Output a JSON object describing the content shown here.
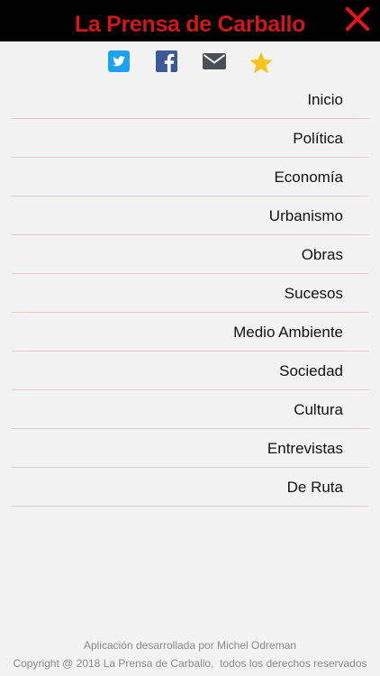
{
  "header": {
    "title": "La Prensa de Carballo",
    "close_icon": "close-icon",
    "title_color": "#d01818",
    "close_color": "#e0171c",
    "background": "#000000"
  },
  "share": {
    "icons": [
      "twitter-icon",
      "facebook-icon",
      "email-icon",
      "star-icon"
    ],
    "colors": {
      "twitter": "#1da1f2",
      "facebook": "#3b5998",
      "email": "#4a4f57",
      "star": "#f6c51c"
    }
  },
  "menu": {
    "items": [
      {
        "label": "Inicio"
      },
      {
        "label": "Política"
      },
      {
        "label": "Economía"
      },
      {
        "label": "Urbanismo"
      },
      {
        "label": "Obras"
      },
      {
        "label": "Sucesos"
      },
      {
        "label": "Medio Ambiente"
      },
      {
        "label": "Sociedad"
      },
      {
        "label": "Cultura"
      },
      {
        "label": "Entrevistas"
      },
      {
        "label": "De Ruta"
      }
    ],
    "divider_color": "#ecc6cb"
  },
  "footer": {
    "credit": "Aplicación desarrollada por Michel Odreman",
    "copyright": "Copyright @ 2018 La Prensa de Carballo,  todos los derechos reservados"
  }
}
